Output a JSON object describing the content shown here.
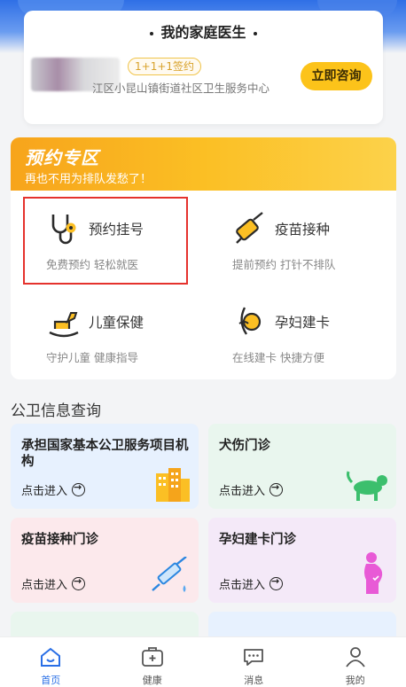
{
  "doctor_card": {
    "title": "我的家庭医生",
    "sign_badge": "1+1+1签约",
    "org_name": "江区小昆山镇街道社区卫生服务中心",
    "consult_button": "立即咨询"
  },
  "booking": {
    "title": "预约专区",
    "subtitle": "再也不用为排队发愁了！",
    "services": [
      {
        "name": "预约挂号",
        "desc": "免费预约  轻松就医",
        "icon": "stethoscope-icon"
      },
      {
        "name": "疫苗接种",
        "desc": "提前预约  打针不排队",
        "icon": "syringe-icon"
      },
      {
        "name": "儿童保健",
        "desc": "守护儿童  健康指导",
        "icon": "rocking-horse-icon"
      },
      {
        "name": "孕妇建卡",
        "desc": "在线建卡  快捷方便",
        "icon": "pregnant-icon"
      }
    ]
  },
  "public_health": {
    "title": "公卫信息查询",
    "enter_label": "点击进入",
    "tiles": [
      {
        "title": "承担国家基本公卫服务项目机构",
        "icon": "building-icon"
      },
      {
        "title": "犬伤门诊",
        "icon": "dog-icon"
      },
      {
        "title": "疫苗接种门诊",
        "icon": "syringe-icon"
      },
      {
        "title": "孕妇建卡门诊",
        "icon": "pregnant-woman-icon"
      }
    ]
  },
  "bottom_nav": [
    {
      "label": "首页",
      "icon": "home-icon",
      "active": true
    },
    {
      "label": "健康",
      "icon": "health-icon",
      "active": false
    },
    {
      "label": "消息",
      "icon": "message-icon",
      "active": false
    },
    {
      "label": "我的",
      "icon": "user-icon",
      "active": false
    }
  ],
  "colors": {
    "accent_blue": "#2a6fe6",
    "yellow": "#fcc31a",
    "highlight_red": "#e5322d"
  }
}
